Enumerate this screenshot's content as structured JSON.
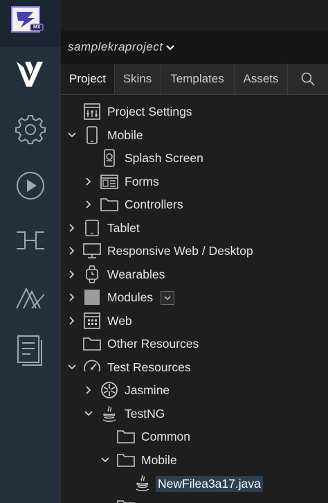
{
  "project": {
    "name": "samplekraproject"
  },
  "logo": {
    "badge": "MX"
  },
  "sidebar": {
    "items": [
      {
        "name": "visualizer-icon"
      },
      {
        "name": "settings-gear-icon"
      },
      {
        "name": "run-play-icon"
      },
      {
        "name": "connect-icon"
      },
      {
        "name": "design-icon"
      },
      {
        "name": "document-icon"
      }
    ]
  },
  "tabs": [
    {
      "label": "Project",
      "active": true
    },
    {
      "label": "Skins"
    },
    {
      "label": "Templates"
    },
    {
      "label": "Assets"
    }
  ],
  "tree": [
    {
      "label": "Project Settings",
      "level": 0,
      "arrow": "none",
      "icon": "settings-panel-icon"
    },
    {
      "label": "Mobile",
      "level": 0,
      "arrow": "down",
      "icon": "mobile-icon"
    },
    {
      "label": "Splash Screen",
      "level": 1,
      "arrow": "none",
      "icon": "splash-screen-icon"
    },
    {
      "label": "Forms",
      "level": 1,
      "arrow": "right",
      "icon": "forms-icon"
    },
    {
      "label": "Controllers",
      "level": 1,
      "arrow": "right",
      "icon": "folder-icon"
    },
    {
      "label": "Tablet",
      "level": 0,
      "arrow": "right",
      "icon": "tablet-icon"
    },
    {
      "label": "Responsive Web / Desktop",
      "level": 0,
      "arrow": "right",
      "icon": "desktop-icon"
    },
    {
      "label": "Wearables",
      "level": 0,
      "arrow": "right",
      "icon": "watch-icon"
    },
    {
      "label": "Modules",
      "level": 0,
      "arrow": "right",
      "icon": "modules-icon"
    },
    {
      "label": "Web",
      "level": 0,
      "arrow": "right",
      "icon": "web-grid-icon"
    },
    {
      "label": "Other Resources",
      "level": 0,
      "arrow": "none",
      "icon": "folder-icon"
    },
    {
      "label": "Test Resources",
      "level": 0,
      "arrow": "down",
      "icon": "gauge-icon"
    },
    {
      "label": "Jasmine",
      "level": 1,
      "arrow": "right",
      "icon": "jasmine-icon"
    },
    {
      "label": "TestNG",
      "level": 1,
      "arrow": "down",
      "icon": "java-icon"
    },
    {
      "label": "Common",
      "level": 2,
      "arrow": "none",
      "icon": "folder-icon"
    },
    {
      "label": "Mobile",
      "level": 2,
      "arrow": "down",
      "icon": "folder-icon"
    },
    {
      "label": "NewFilea3a17.java",
      "level": 3,
      "arrow": "none",
      "icon": "java-icon",
      "selected": true
    },
    {
      "label": "",
      "level": 2,
      "arrow": "none",
      "icon": "folder-icon"
    }
  ]
}
